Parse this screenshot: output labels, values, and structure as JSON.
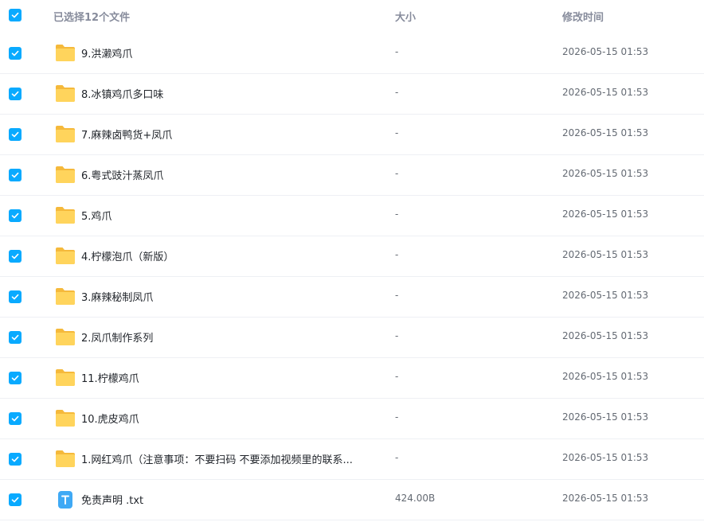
{
  "header": {
    "selected_label": "已选择12个文件",
    "size_label": "大小",
    "modified_label": "修改时间"
  },
  "colors": {
    "checkbox": "#09aaff",
    "folder_back": "#f5b93b",
    "folder_front": "#ffd45c",
    "txt_icon": "#3fa9f5"
  },
  "files": [
    {
      "name": "9.洪濑鸡爪",
      "size": "-",
      "modified": "2026-05-15 01:53",
      "type": "folder",
      "checked": true
    },
    {
      "name": "8.冰镇鸡爪多口味",
      "size": "-",
      "modified": "2026-05-15 01:53",
      "type": "folder",
      "checked": true
    },
    {
      "name": "7.麻辣卤鸭货+凤爪",
      "size": "-",
      "modified": "2026-05-15 01:53",
      "type": "folder",
      "checked": true
    },
    {
      "name": "6.粤式豉汁蒸凤爪",
      "size": "-",
      "modified": "2026-05-15 01:53",
      "type": "folder",
      "checked": true
    },
    {
      "name": "5.鸡爪",
      "size": "-",
      "modified": "2026-05-15 01:53",
      "type": "folder",
      "checked": true
    },
    {
      "name": "4.柠檬泡爪（新版）",
      "size": "-",
      "modified": "2026-05-15 01:53",
      "type": "folder",
      "checked": true
    },
    {
      "name": "3.麻辣秘制凤爪",
      "size": "-",
      "modified": "2026-05-15 01:53",
      "type": "folder",
      "checked": true
    },
    {
      "name": "2.凤爪制作系列",
      "size": "-",
      "modified": "2026-05-15 01:53",
      "type": "folder",
      "checked": true
    },
    {
      "name": "11.柠檬鸡爪",
      "size": "-",
      "modified": "2026-05-15 01:53",
      "type": "folder",
      "checked": true
    },
    {
      "name": "10.虎皮鸡爪",
      "size": "-",
      "modified": "2026-05-15 01:53",
      "type": "folder",
      "checked": true
    },
    {
      "name": "1.网红鸡爪（注意事项：不要扫码 不要添加视频里的联系...",
      "size": "-",
      "modified": "2026-05-15 01:53",
      "type": "folder",
      "checked": true
    },
    {
      "name": "免责声明 .txt",
      "size": "424.00B",
      "modified": "2026-05-15 01:53",
      "type": "txt",
      "checked": true
    }
  ]
}
